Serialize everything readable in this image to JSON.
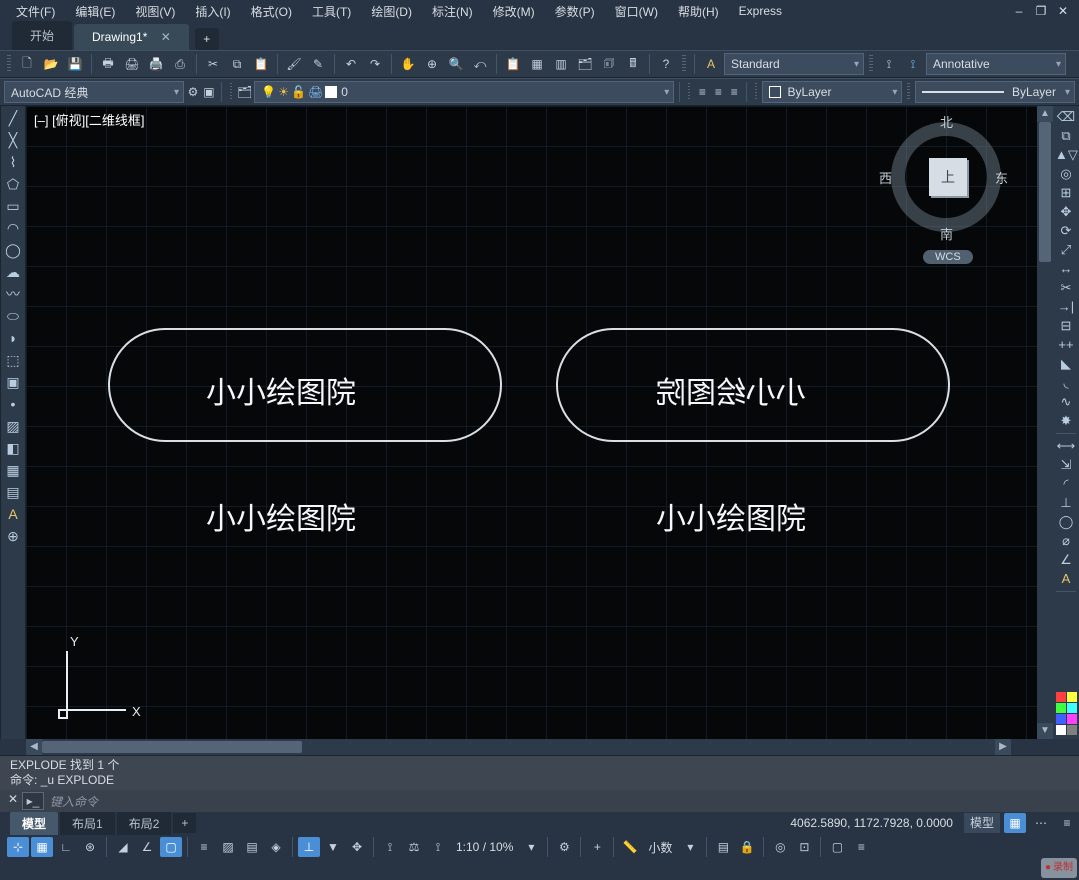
{
  "menu": {
    "items": [
      "文件(F)",
      "编辑(E)",
      "视图(V)",
      "插入(I)",
      "格式(O)",
      "工具(T)",
      "绘图(D)",
      "标注(N)",
      "修改(M)",
      "参数(P)",
      "窗口(W)",
      "帮助(H)",
      "Express"
    ]
  },
  "window_controls": {
    "min": "–",
    "restore": "❐",
    "close": "✕"
  },
  "tabs": {
    "start": "开始",
    "drawing": "Drawing1*",
    "close": "✕",
    "add": "+"
  },
  "toolbar1": {
    "text_style": "Standard",
    "annotation_style": "Annotative"
  },
  "toolbar2": {
    "workspace": "AutoCAD 经典",
    "layer_value": "0",
    "layer_prop": "ByLayer",
    "linetype": "ByLayer"
  },
  "canvas": {
    "viewport_label": "[–] [俯视][二维线框]",
    "text1": "小小绘图院",
    "text2": "小小绘图院",
    "text3": "小小绘图院",
    "text4": "小小绘图院",
    "ucs_x": "X",
    "ucs_y": "Y",
    "cube_top": "上",
    "dir_n": "北",
    "dir_s": "南",
    "dir_w": "西",
    "dir_e": "东",
    "wcs": "WCS"
  },
  "command": {
    "line1": "EXPLODE 找到  1  个",
    "line2": "命令: _u EXPLODE",
    "placeholder": "键入命令",
    "toggle": "✕",
    "icon": "▸_"
  },
  "layout": {
    "model": "模型",
    "layout1": "布局1",
    "layout2": "布局2",
    "add": "+"
  },
  "status": {
    "coords": "4062.5890, 1172.7928, 0.0000",
    "model_btn": "模型",
    "scale": "1:10 / 10%",
    "precision": "小数"
  },
  "record": "录制"
}
